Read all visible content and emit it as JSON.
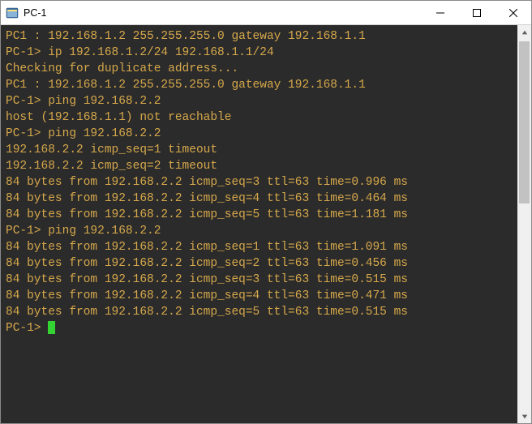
{
  "window": {
    "title": "PC-1"
  },
  "terminal": {
    "lines": [
      "PC1 : 192.168.1.2 255.255.255.0 gateway 192.168.1.1",
      "",
      "PC-1> ip 192.168.1.2/24 192.168.1.1/24",
      "Checking for duplicate address...",
      "PC1 : 192.168.1.2 255.255.255.0 gateway 192.168.1.1",
      "",
      "PC-1> ping 192.168.2.2",
      "host (192.168.1.1) not reachable",
      "",
      "PC-1> ping 192.168.2.2",
      "192.168.2.2 icmp_seq=1 timeout",
      "192.168.2.2 icmp_seq=2 timeout",
      "84 bytes from 192.168.2.2 icmp_seq=3 ttl=63 time=0.996 ms",
      "84 bytes from 192.168.2.2 icmp_seq=4 ttl=63 time=0.464 ms",
      "84 bytes from 192.168.2.2 icmp_seq=5 ttl=63 time=1.181 ms",
      "",
      "PC-1> ping 192.168.2.2",
      "84 bytes from 192.168.2.2 icmp_seq=1 ttl=63 time=1.091 ms",
      "84 bytes from 192.168.2.2 icmp_seq=2 ttl=63 time=0.456 ms",
      "84 bytes from 192.168.2.2 icmp_seq=3 ttl=63 time=0.515 ms",
      "84 bytes from 192.168.2.2 icmp_seq=4 ttl=63 time=0.471 ms",
      "84 bytes from 192.168.2.2 icmp_seq=5 ttl=63 time=0.515 ms",
      ""
    ],
    "prompt": "PC-1> "
  },
  "colors": {
    "terminal_bg": "#2b2b2b",
    "terminal_fg": "#d6a84b",
    "cursor": "#34d334"
  }
}
